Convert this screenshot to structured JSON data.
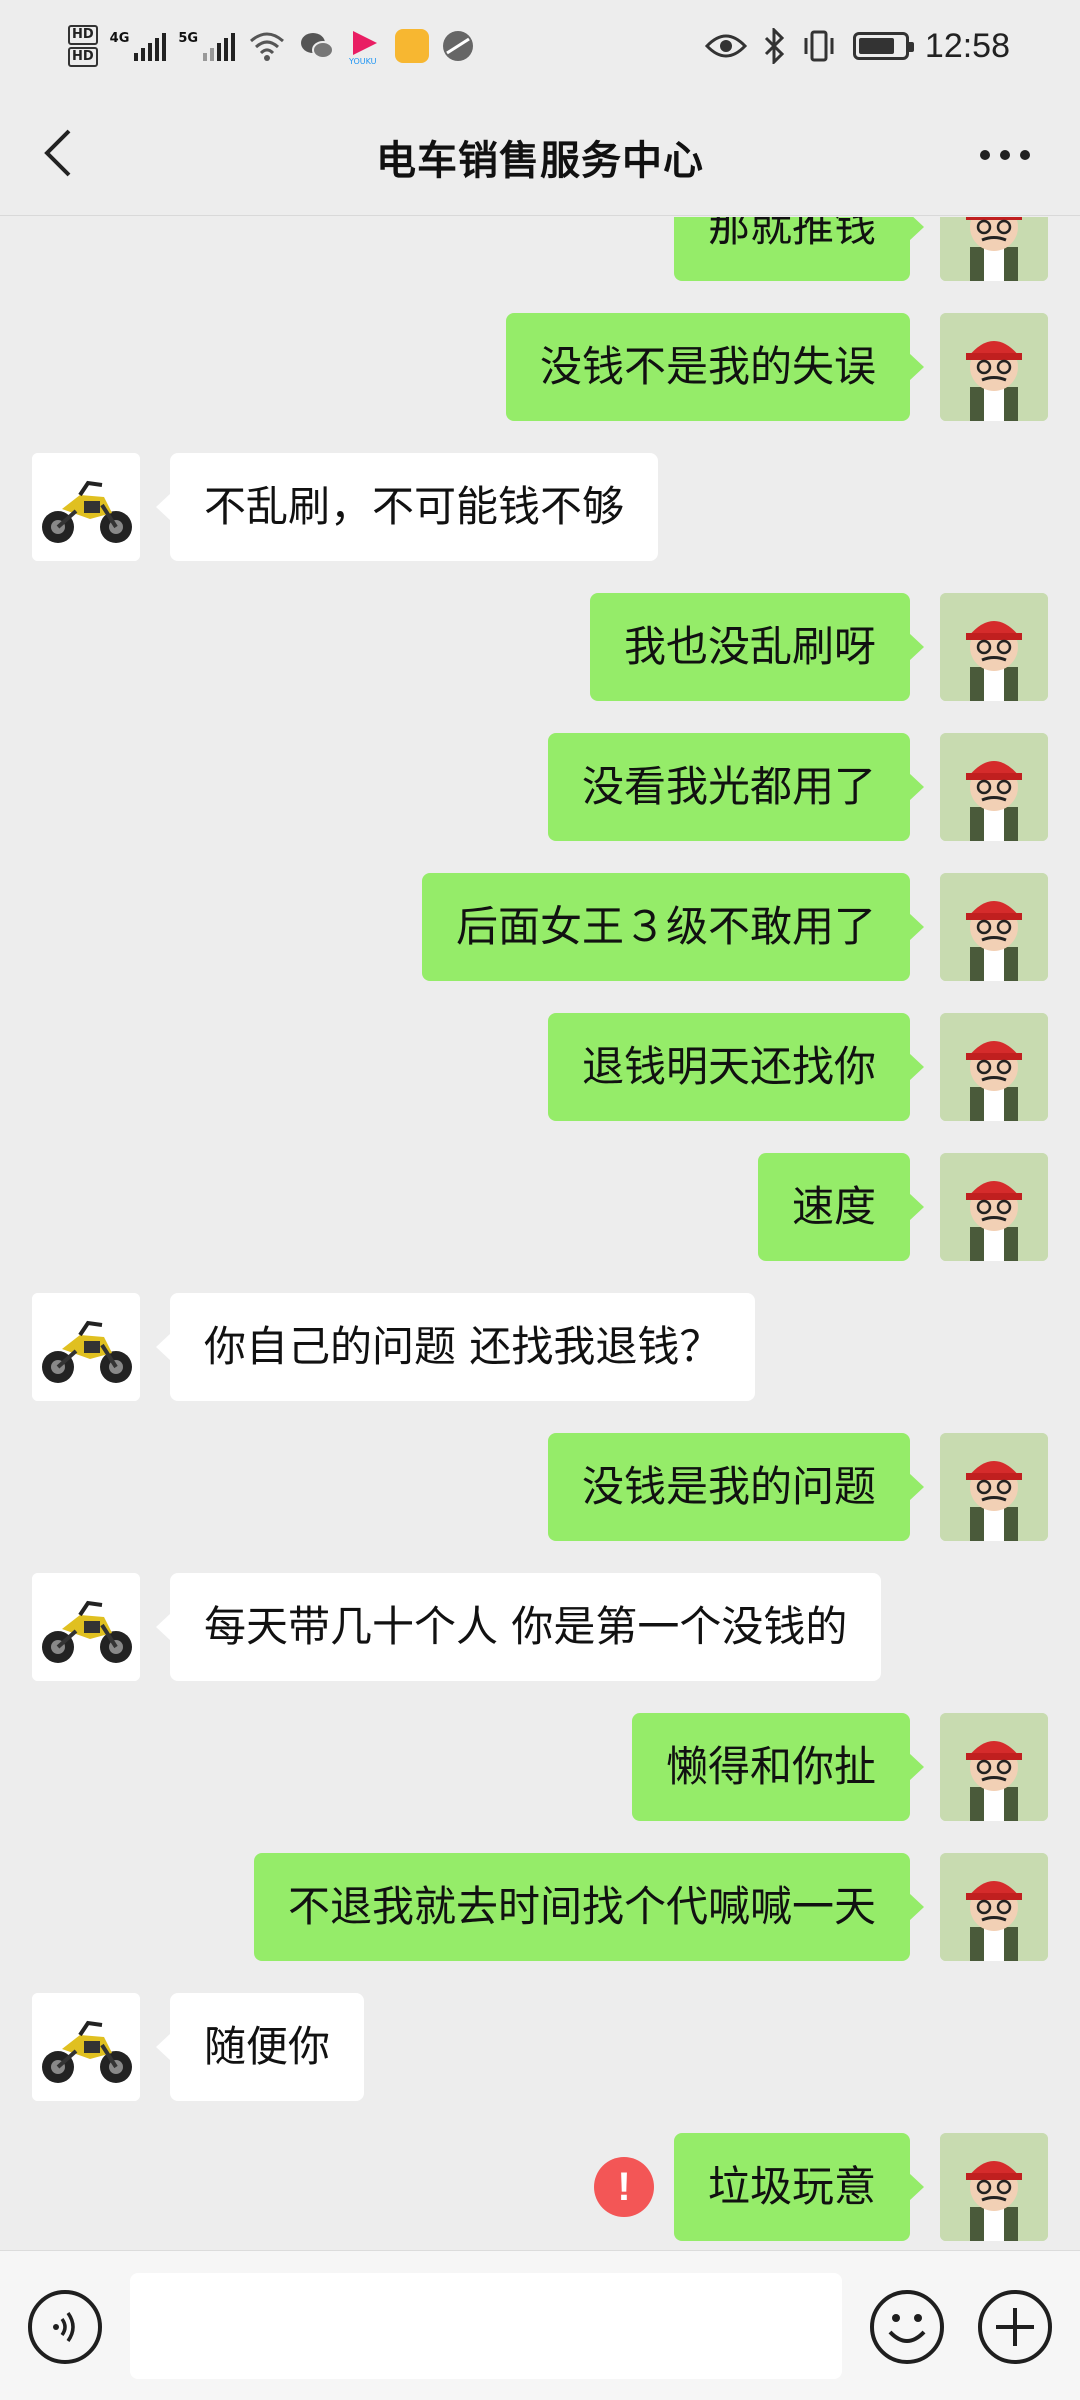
{
  "status_bar": {
    "time": "12:58",
    "hd1": "HD",
    "hd2": "HD",
    "net1": "4G",
    "net2": "5G"
  },
  "header": {
    "title": "电车销售服务中心",
    "back_icon": "chevron-left-icon",
    "more_icon": "more-dots-icon"
  },
  "messages": [
    {
      "side": "right",
      "text": "那就推钱"
    },
    {
      "side": "right",
      "text": "没钱不是我的失误"
    },
    {
      "side": "left",
      "text": "不乱刷，不可能钱不够"
    },
    {
      "side": "right",
      "text": "我也没乱刷呀"
    },
    {
      "side": "right",
      "text": "没看我光都用了"
    },
    {
      "side": "right",
      "text": "后面女王３级不敢用了"
    },
    {
      "side": "right",
      "text": "退钱明天还找你"
    },
    {
      "side": "right",
      "text": "速度"
    },
    {
      "side": "left",
      "text": "你自己的问题  还找我退钱？"
    },
    {
      "side": "right",
      "text": "没钱是我的问题"
    },
    {
      "side": "left",
      "text": "每天带几十个人 你是第一个没钱的"
    },
    {
      "side": "right",
      "text": "懒得和你扯"
    },
    {
      "side": "right",
      "text": "不退我就去时间找个代喊喊一天"
    },
    {
      "side": "left",
      "text": "随便你"
    },
    {
      "side": "right",
      "text": "垃圾玩意",
      "failed": true
    }
  ],
  "failed_mark": "!",
  "colors": {
    "background": "#ededed",
    "sent_bubble": "#95ec69",
    "received_bubble": "#ffffff",
    "error": "#f35656"
  },
  "input_bar": {
    "voice_icon": "voice-icon",
    "emoji_icon": "emoji-icon",
    "plus_icon": "plus-icon"
  }
}
